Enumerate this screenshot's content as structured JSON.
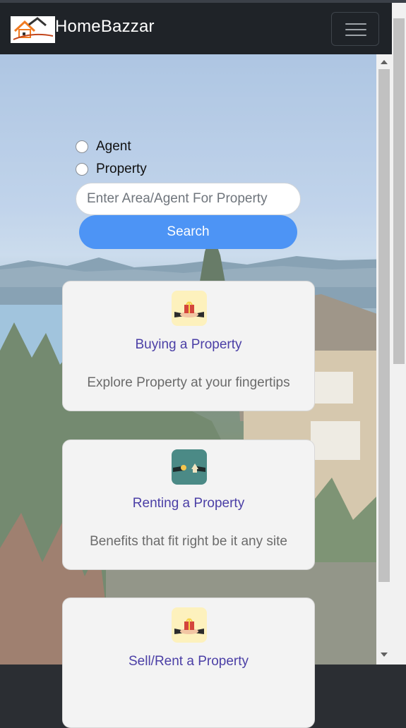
{
  "brand": {
    "name": "HomeBazzar"
  },
  "search": {
    "radio_agent": "Agent",
    "radio_property": "Property",
    "placeholder": "Enter Area/Agent For Property",
    "button": "Search"
  },
  "cards": [
    {
      "title": "Buying a Property",
      "desc": "Explore Property at your fingertips",
      "icon": "gift-house-icon"
    },
    {
      "title": "Renting a Property",
      "desc": "Benefits that fit right be it any site",
      "icon": "key-house-icon"
    },
    {
      "title": "Sell/Rent a Property",
      "desc": "",
      "icon": "gift-house-icon"
    }
  ],
  "colors": {
    "navbar": "#1f2328",
    "accent": "#4d94f5",
    "card_title": "#4b3fa6"
  }
}
